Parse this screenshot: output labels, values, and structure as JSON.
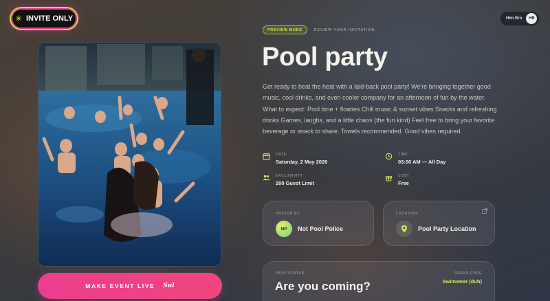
{
  "badge": {
    "label": "INVITE ONLY"
  },
  "user": {
    "name": "Him Bro",
    "initials": "HB"
  },
  "header": {
    "preview_label": "PREVIEW MODE",
    "review_label": "REVIEW YOUR INVITATION"
  },
  "event": {
    "title": "Pool party",
    "description": "Get ready to beat the heat with a laid-back pool party! We're bringing together good music, cool drinks, and even cooler company for an afternoon of fun by the water. What to expect: Pool time + floaties Chill music & sunset vibes Snacks and refreshing drinks Games, laughs, and a little chaos (the fun kind) Feel free to bring your favorite beverage or snack to share. Towels recommended. Good vibes required."
  },
  "details": {
    "date": {
      "label": "DATE",
      "value": "Saturday, 2 May 2026"
    },
    "time": {
      "label": "TIME",
      "value": "03:00 AM — All Day"
    },
    "exclusivity": {
      "label": "EXCLUSIVITY",
      "value": "200 Guest Limit"
    },
    "cost": {
      "label": "COST",
      "value": "Free"
    }
  },
  "host": {
    "label": "HOSTED BY",
    "initials": "NP",
    "name": "Not Pool Police"
  },
  "location": {
    "label": "LOCATION",
    "name": "Pool Party Location"
  },
  "rsvp": {
    "label": "RSVP STATUS",
    "question": "Are you coming?",
    "dress_code_label": "DRESS CODE",
    "dress_code_value": "Swimwear (duh)"
  },
  "cta": {
    "label": "MAKE EVENT LIVE",
    "signature": "Sul"
  },
  "colors": {
    "accent_pink": "#ec3d8e",
    "accent_lime": "#cde85a"
  },
  "icons": {
    "badge": "sparkle-icon",
    "date": "calendar-icon",
    "time": "clock-icon",
    "exclusivity": "users-icon",
    "cost": "gift-icon",
    "location": "map-pin-icon",
    "external": "external-link-icon"
  }
}
